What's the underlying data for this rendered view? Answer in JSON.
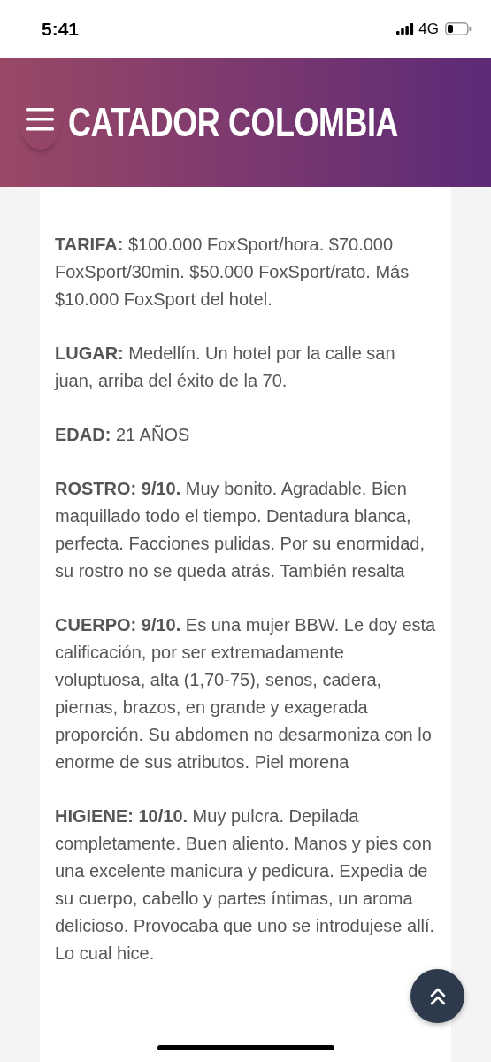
{
  "status_bar": {
    "time": "5:41",
    "network": "4G"
  },
  "header": {
    "title": "CATADOR COLOMBIA"
  },
  "paragraphs": [
    {
      "label": "TARIFA:",
      "text": "$100.000 FoxSport/hora. $70.000 FoxSport/30min. $50.000 FoxSport/rato. Más $10.000 FoxSport del hotel."
    },
    {
      "label": "LUGAR:",
      "text": "Medellín. Un hotel por la calle san juan, arriba del éxito de la 70."
    },
    {
      "label": "EDAD:",
      "text": "21 AÑOS"
    },
    {
      "label": "ROSTRO: 9/10.",
      "text": "Muy bonito. Agradable. Bien maquillado todo el tiempo. Dentadura blanca, perfecta. Facciones pulidas. Por su enormidad, su rostro no se queda atrás. También resalta"
    },
    {
      "label": "CUERPO: 9/10.",
      "text": "Es una mujer BBW. Le doy esta calificación, por ser extremadamente voluptuosa, alta (1,70-75), senos, cadera, piernas, brazos, en grande y exagerada proporción. Su abdomen no desarmoniza con lo enorme de sus atributos. Piel morena"
    },
    {
      "label": "HIGIENE: 10/10.",
      "text": "Muy pulcra. Depilada completamente. Buen aliento. Manos y pies con una excelente manicura y pedicura. Expedia de su cuerpo, cabello y partes íntimas, un aroma delicioso. Provocaba que uno se introdujese allí. Lo cual hice."
    }
  ]
}
